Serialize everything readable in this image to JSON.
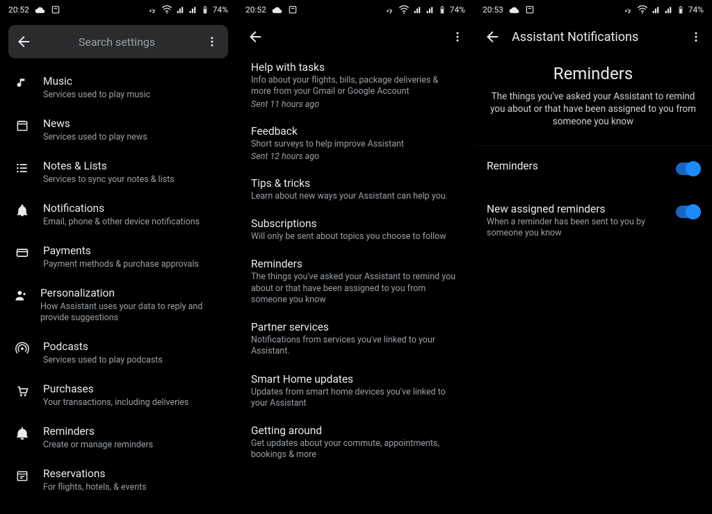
{
  "status": {
    "time_a": "20:52",
    "time_b": "20:52",
    "time_c": "20:53",
    "battery": "74%"
  },
  "search": {
    "placeholder": "Search settings"
  },
  "settings": [
    {
      "icon": "music-icon",
      "title": "Music",
      "sub": "Services used to play music"
    },
    {
      "icon": "news-icon",
      "title": "News",
      "sub": "Services used to play news"
    },
    {
      "icon": "list-icon",
      "title": "Notes & Lists",
      "sub": "Services to sync your notes & lists"
    },
    {
      "icon": "bell-icon",
      "title": "Notifications",
      "sub": "Email, phone & other device notifications"
    },
    {
      "icon": "card-icon",
      "title": "Payments",
      "sub": "Payment methods & purchase approvals"
    },
    {
      "icon": "person-icon",
      "title": "Personalization",
      "sub": "How Assistant uses your data to reply and provide suggestions"
    },
    {
      "icon": "podcast-icon",
      "title": "Podcasts",
      "sub": "Services used to play podcasts"
    },
    {
      "icon": "cart-icon",
      "title": "Purchases",
      "sub": "Your transactions, including deliveries"
    },
    {
      "icon": "remind-icon",
      "title": "Reminders",
      "sub": "Create or manage reminders"
    },
    {
      "icon": "ticket-icon",
      "title": "Reservations",
      "sub": "For flights, hotels, & events"
    }
  ],
  "notifs": [
    {
      "title": "Help with tasks",
      "sub": "Info about your flights, bills, package deliveries & more from your Gmail or Google Account",
      "meta": "Sent 11 hours ago"
    },
    {
      "title": "Feedback",
      "sub": "Short surveys to help improve Assistant",
      "meta": "Sent 12 hours ago"
    },
    {
      "title": "Tips & tricks",
      "sub": "Learn about new ways your Assistant can help you."
    },
    {
      "title": "Subscriptions",
      "sub": "Will only be sent about topics you choose to follow"
    },
    {
      "title": "Reminders",
      "sub": "The things you've asked your Assistant to remind you about or that have been assigned to you from someone you know"
    },
    {
      "title": "Partner services",
      "sub": "Notifications from services you've linked to your Assistant."
    },
    {
      "title": "Smart Home updates",
      "sub": "Updates from smart home devices you've linked to your Assistant"
    },
    {
      "title": "Getting around",
      "sub": "Get updates about your commute, appointments, bookings & more"
    }
  ],
  "col3": {
    "appbar_title": "Assistant Notifications",
    "head": "Reminders",
    "head_desc": "The things you've asked your Assistant to remind you about or that have been assigned to you from someone you know",
    "rows": [
      {
        "title": "Reminders",
        "sub": ""
      },
      {
        "title": "New assigned reminders",
        "sub": "When a reminder has been sent to you by someone you know"
      }
    ]
  }
}
